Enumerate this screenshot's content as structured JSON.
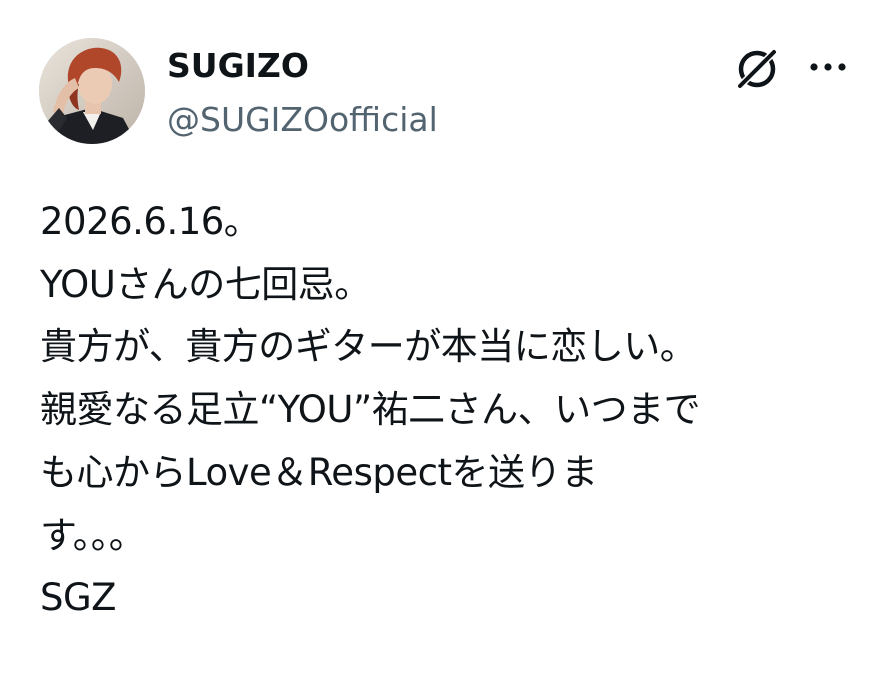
{
  "author": {
    "display_name": "SUGIZO",
    "handle": "@SUGIZOofficial",
    "avatar_icon": "profile-photo"
  },
  "header_actions": {
    "grok_icon": "grok-icon",
    "more_icon": "more-options-icon"
  },
  "tweet": {
    "lines": [
      "2026.6.16。",
      "YOUさんの七回忌。",
      "貴方が、貴方のギターが本当に恋しい。",
      "親愛なる足立“YOU”祐二さん、いつまで",
      "も心からLove＆Respectを送りま",
      "す。。。",
      "SGZ"
    ]
  },
  "colors": {
    "text_primary": "#0f1419",
    "text_secondary": "#536471",
    "background": "#ffffff"
  }
}
